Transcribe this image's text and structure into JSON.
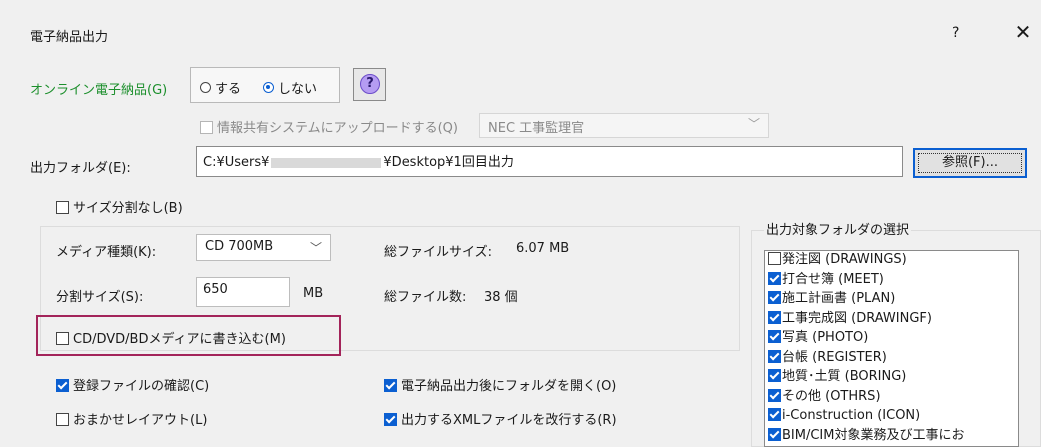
{
  "window": {
    "title": "電子納品出力",
    "help": "?",
    "close": "✕"
  },
  "online": {
    "label": "オンライン電子納品(G)",
    "opt_yes": "する",
    "opt_no": "しない",
    "help_icon": "?"
  },
  "share": {
    "label": "情報共有システムにアップロードする(Q)",
    "system": "NEC 工事監理官"
  },
  "output": {
    "label": "出力フォルダ(E):",
    "path_prefix": "C:¥Users¥",
    "path_suffix": "¥Desktop¥1回目出力",
    "browse": "参照(F)..."
  },
  "no_split": "サイズ分割なし(B)",
  "media": {
    "type_label": "メディア種類(K):",
    "type_value": "CD  700MB",
    "total_size_label": "総ファイルサイズ:",
    "total_size_value": "6.07 MB",
    "split_label": "分割サイズ(S):",
    "split_value": "650",
    "split_unit": "MB",
    "total_files_label": "総ファイル数:",
    "total_files_value": "38 個",
    "burn_label": "CD/DVD/BDメディアに書き込む(M)"
  },
  "options": {
    "confirm_files": "登録ファイルの確認(C)",
    "auto_layout": "おまかせレイアウト(L)",
    "open_folder": "電子納品出力後にフォルダを開く(O)",
    "xml_newline": "出力するXMLファイルを改行する(R)"
  },
  "folders": {
    "group_label": "出力対象フォルダの選択",
    "items": [
      {
        "label": "発注図 (DRAWINGS)",
        "checked": false
      },
      {
        "label": "打合せ簿 (MEET)",
        "checked": true
      },
      {
        "label": "施工計画書 (PLAN)",
        "checked": true
      },
      {
        "label": "工事完成図 (DRAWINGF)",
        "checked": true
      },
      {
        "label": "写真 (PHOTO)",
        "checked": true
      },
      {
        "label": "台帳 (REGISTER)",
        "checked": true
      },
      {
        "label": "地質･土質 (BORING)",
        "checked": true
      },
      {
        "label": "その他 (OTHRS)",
        "checked": true
      },
      {
        "label": "i-Construction (ICON)",
        "checked": true
      },
      {
        "label": "BIM/CIM対象業務及び工事にお",
        "checked": true
      }
    ]
  },
  "colors": {
    "accent": "#0b5fd1",
    "highlight": "#a3245a",
    "online_label": "#1c8f2c"
  }
}
